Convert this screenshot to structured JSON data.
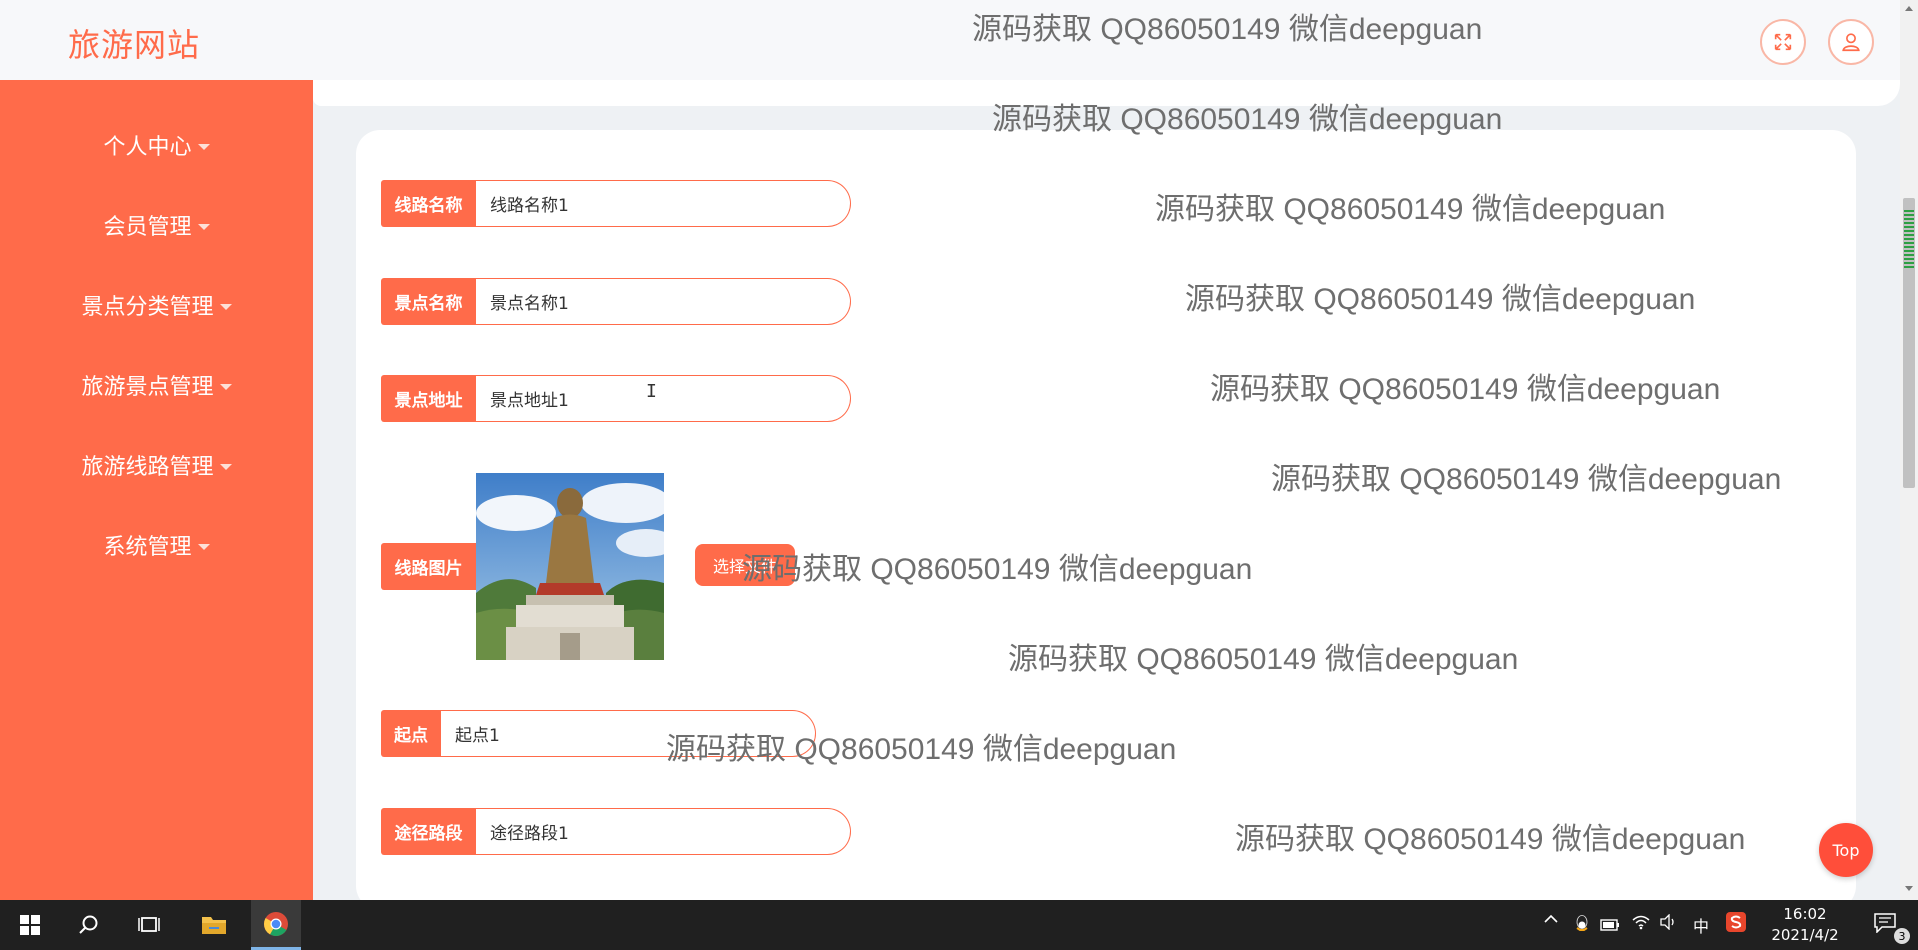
{
  "site": {
    "title": "旅游网站"
  },
  "sidebar": {
    "items": [
      {
        "label": "个人中心"
      },
      {
        "label": "会员管理"
      },
      {
        "label": "景点分类管理"
      },
      {
        "label": "旅游景点管理"
      },
      {
        "label": "旅游线路管理"
      },
      {
        "label": "系统管理"
      }
    ]
  },
  "form": {
    "route_name": {
      "label": "线路名称",
      "value": "线路名称1"
    },
    "spot_name": {
      "label": "景点名称",
      "value": "景点名称1"
    },
    "spot_address": {
      "label": "景点地址",
      "value": "景点地址1"
    },
    "route_image": {
      "label": "线路图片",
      "choose_label": "选择文件"
    },
    "start": {
      "label": "起点",
      "value": "起点1"
    },
    "waypoints": {
      "label": "途径路段",
      "value": "途径路段1"
    }
  },
  "watermark": "源码获取 QQ86050149 微信deepguan",
  "top_button": "Top",
  "taskbar": {
    "ime_label": "中",
    "time": "16:02",
    "date": "2021/4/2",
    "notification_count": "3"
  },
  "colors": {
    "accent": "#ff6b4a"
  }
}
